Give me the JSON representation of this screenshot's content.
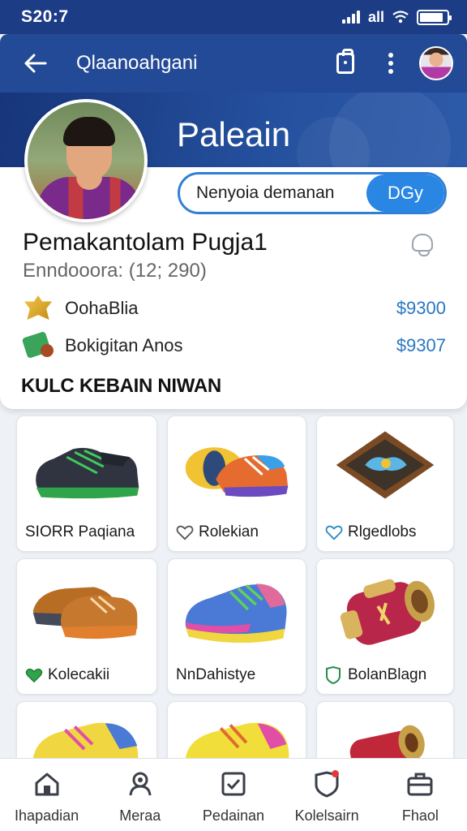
{
  "status": {
    "time": "S20:7",
    "network": "all"
  },
  "header": {
    "title": "Qlaanoahgani"
  },
  "banner": {
    "title": "Paleain"
  },
  "follow": {
    "label": "Nenyoia demanan",
    "state": "DGy"
  },
  "player": {
    "name": "Pemakantolam Pugja1",
    "subtitle": "Enndooora: (12; 290)"
  },
  "stats": [
    {
      "label": "OohaBlia",
      "value": "$9300",
      "icon": "gold-badge-icon"
    },
    {
      "label": "Bokigitan Anos",
      "value": "$9307",
      "icon": "green-boot-icon"
    }
  ],
  "section": {
    "title": "KULC KEBAIN NIWAN"
  },
  "items": [
    {
      "label": "SIORR Paqiana",
      "badge": "none",
      "art": "black-green-boot"
    },
    {
      "label": "Rolekian",
      "badge": "heart-outline",
      "art": "colorful-sneaker-pair"
    },
    {
      "label": "Rlgedlobs",
      "badge": "heart-outline-blue",
      "art": "framed-badge"
    },
    {
      "label": "Kolecakii",
      "badge": "heart-filled-green",
      "art": "brown-sneaker-pair"
    },
    {
      "label": "NnDahistye",
      "badge": "none",
      "art": "rainbow-sneaker"
    },
    {
      "label": "BolanBlagn",
      "badge": "shield-outline",
      "art": "red-cannon"
    },
    {
      "label": "",
      "badge": "none",
      "art": "yellow-sneaker"
    },
    {
      "label": "",
      "badge": "none",
      "art": "yellow-sneaker-2"
    },
    {
      "label": "",
      "badge": "none",
      "art": "red-item"
    }
  ],
  "nav": [
    {
      "label": "Ihapadian",
      "icon": "home-icon"
    },
    {
      "label": "Meraa",
      "icon": "profile-icon"
    },
    {
      "label": "Pedainan",
      "icon": "checkbox-icon"
    },
    {
      "label": "Kolelsairn",
      "icon": "shield-icon"
    },
    {
      "label": "Fhaol",
      "icon": "briefcase-icon"
    }
  ]
}
